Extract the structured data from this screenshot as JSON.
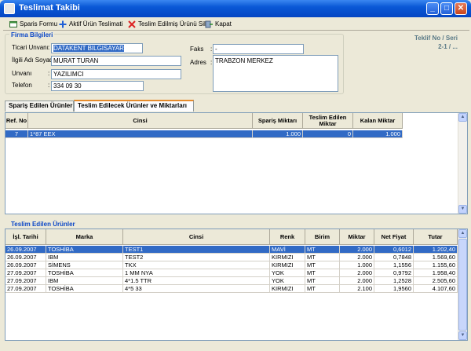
{
  "window": {
    "title": "Teslimat Takibi",
    "minimize": "_",
    "maximize": "□",
    "close": "✕"
  },
  "toolbar": {
    "siparis_formu": "Sparis Formu",
    "aktif_urun": "Aktif Ürün Teslimati",
    "sil": "Teslim Edilmiş Ürünü Sil",
    "kapat": "Kapat"
  },
  "firma": {
    "group_title": "Firma Bilgileri",
    "ticari_label": "Ticari Unvanı",
    "ticari_value": "DATAKENT BILGISAYAR",
    "ilgili_label": "İlgili Adı Soyadı",
    "ilgili_value": "MURAT TURAN",
    "unvan_label": "Unvanı",
    "unvan_value": "YAZILIMCI",
    "telefon_label": "Telefon",
    "telefon_value": "334 09 30",
    "faks_label": "Faks",
    "faks_value": "-",
    "adres_label": "Adres",
    "adres_value": "TRABZON MERKEZ"
  },
  "teklif": {
    "label": "Teklif No / Seri",
    "value": "2-1 / ..."
  },
  "tabs": [
    "Spariş Edilen Ürünler",
    "Teslim Edilecek Ürünler ve Miktarları"
  ],
  "upper_grid": {
    "headers": [
      "Ref. No",
      "Cinsi",
      "Spariş Miktarı",
      "Teslim Edilen Miktar",
      "Kalan Miktar"
    ],
    "rows": [
      [
        "7",
        "1*87 EEX",
        "1.000",
        "0",
        "1.000"
      ]
    ]
  },
  "lower_panel_title": "Teslim Edilen Ürünler",
  "lower_grid": {
    "headers": [
      "İşl. Tarihi",
      "Marka",
      "Cinsi",
      "Renk",
      "Birim",
      "Miktar",
      "Net Fiyat",
      "Tutar"
    ],
    "rows": [
      [
        "26.09.2007",
        "TOSHİBA",
        "TEST1",
        "MAVİ",
        "MT",
        "2.000",
        "0,6012",
        "1.202,40"
      ],
      [
        "26.09.2007",
        "IBM",
        "TEST2",
        "KIRMIZI",
        "MT",
        "2.000",
        "0,7848",
        "1.569,60"
      ],
      [
        "26.09.2007",
        "SİMENS",
        "TKX",
        "KIRMIZI",
        "MT",
        "1.000",
        "1,1556",
        "1.155,60"
      ],
      [
        "27.09.2007",
        "TOSHİBA",
        "1 MM NYA",
        "YOK",
        "MT",
        "2.000",
        "0,9792",
        "1.958,40"
      ],
      [
        "27.09.2007",
        "IBM",
        "4*1.5 TTR",
        "YOK",
        "MT",
        "2.000",
        "1,2528",
        "2.505,60"
      ],
      [
        "27.09.2007",
        "TOSHİBA",
        "4*5 33",
        "KIRMIZI",
        "MT",
        "2.100",
        "1,9560",
        "4.107,60"
      ]
    ]
  }
}
